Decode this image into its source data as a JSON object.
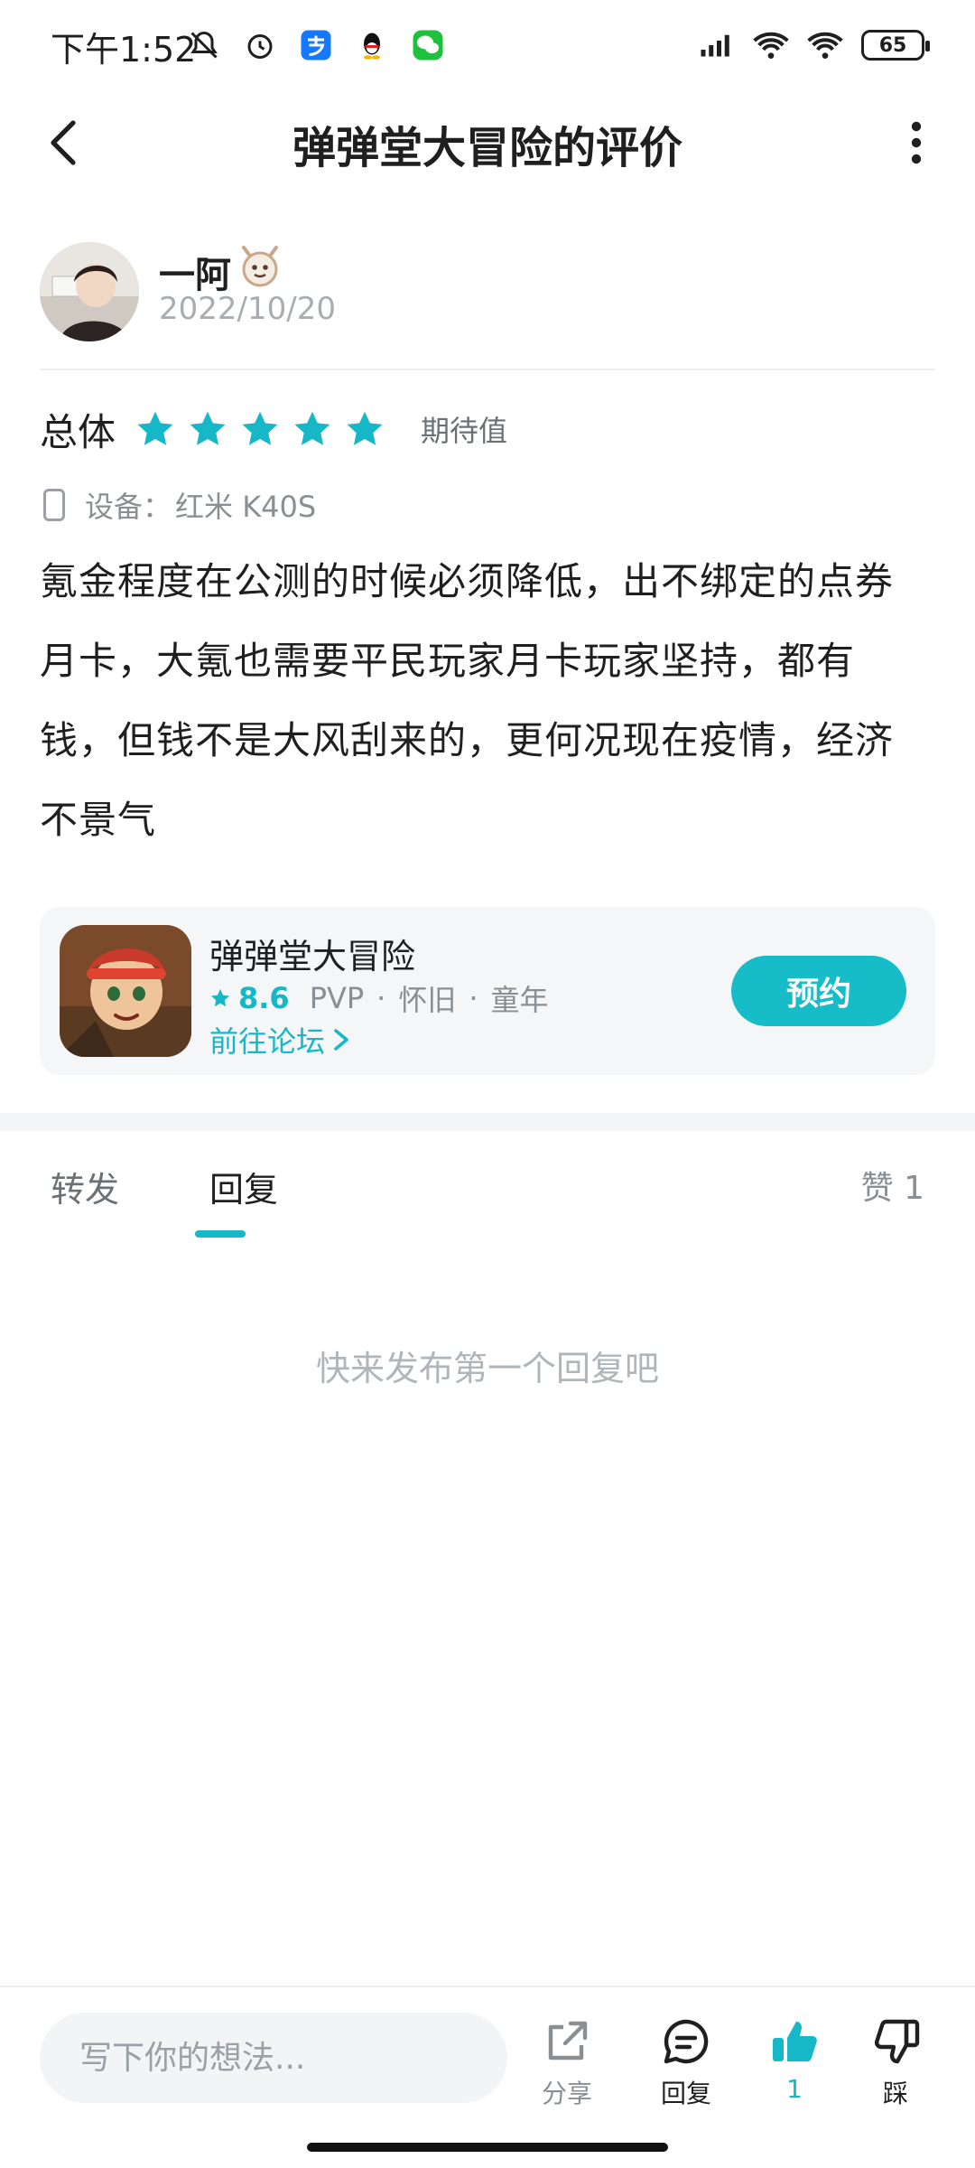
{
  "status_bar": {
    "time": "下午1:52",
    "battery": "65"
  },
  "header": {
    "title": "弹弹堂大冒险的评价",
    "back_icon": "chevron-left-icon",
    "more_icon": "more-vertical-icon"
  },
  "author": {
    "name": "一阿",
    "date": "2022/10/20"
  },
  "rating": {
    "label": "总体",
    "stars": 5,
    "max_stars": 5,
    "tag": "期待值",
    "star_color": "#16b7c6"
  },
  "device": {
    "label": "设备：",
    "value": "红米 K40S"
  },
  "review": {
    "lines": [
      "氪金程度在公测的时候必须降低，出不绑定的点券",
      "月卡，大氪也需要平民玩家月卡玩家坚持，都有",
      "钱，但钱不是大风刮来的，更何况现在疫情，经济",
      "不景气"
    ]
  },
  "game": {
    "name": "弹弹堂大冒险",
    "score": "8.6",
    "tags": [
      "PVP",
      "怀旧",
      "童年"
    ],
    "forum_link": "前往论坛",
    "reserve_label": "预约"
  },
  "tabs": {
    "items": [
      {
        "label": "转发"
      },
      {
        "label": "回复"
      }
    ],
    "active_index": 1,
    "likes_label": "赞 1"
  },
  "empty_state": "快来发布第一个回复吧",
  "bottom_bar": {
    "input_placeholder": "写下你的想法...",
    "share_label": "分享",
    "reply_label": "回复",
    "like_count": "1",
    "dislike_label": "踩"
  },
  "colors": {
    "accent": "#16b7c6",
    "text": "#1f1f1f",
    "muted": "#8a8f94"
  }
}
